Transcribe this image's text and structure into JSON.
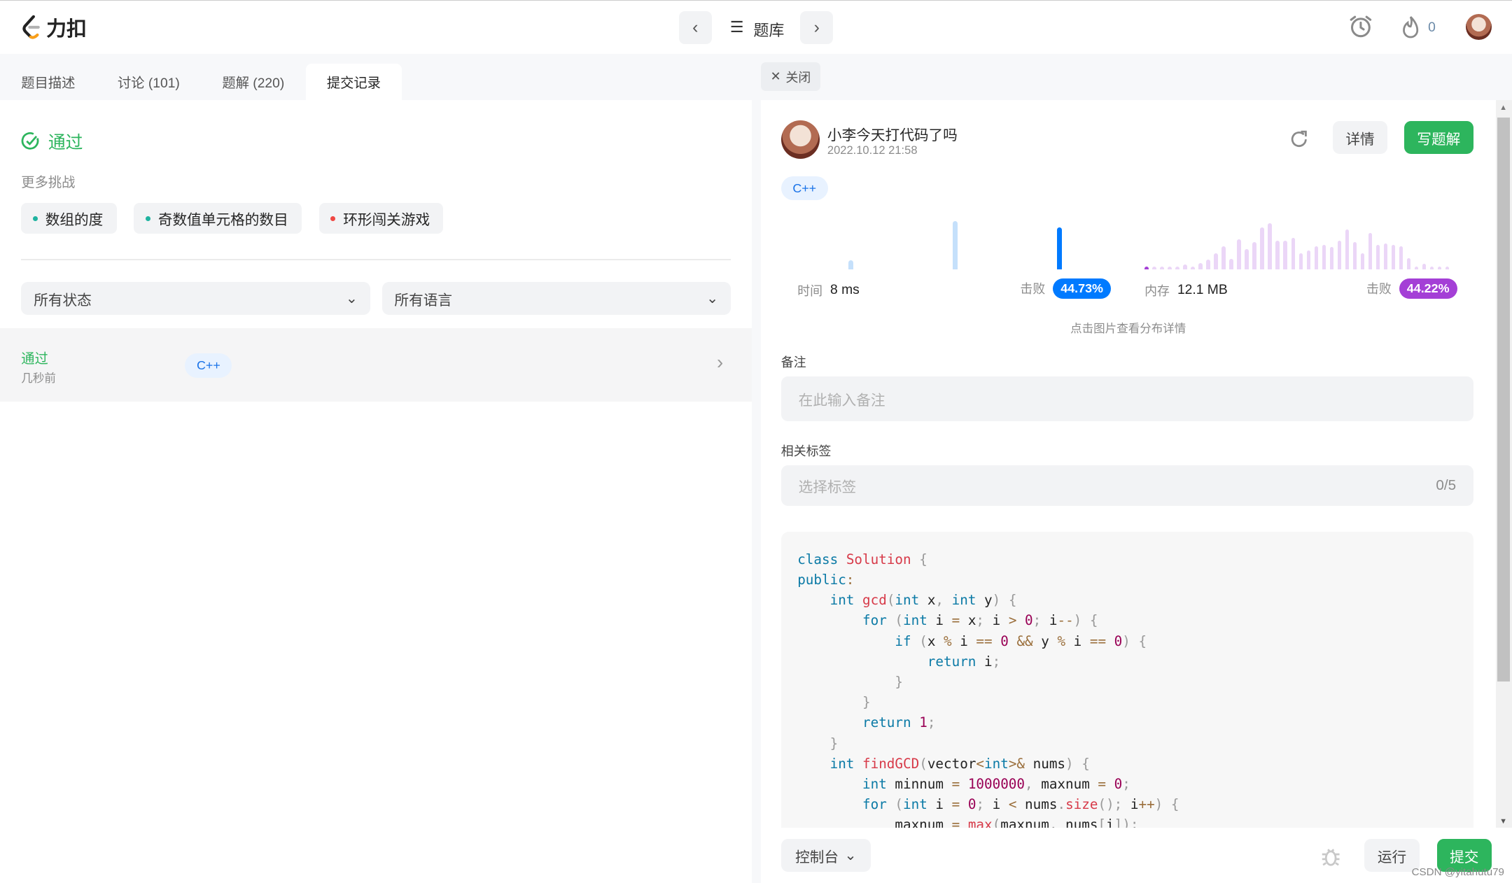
{
  "app": {
    "logo_text": "力扣",
    "center_title": "题库",
    "streak_count": "0"
  },
  "tabs": [
    {
      "label": "题目描述"
    },
    {
      "label": "讨论 (101)"
    },
    {
      "label": "题解 (220)"
    },
    {
      "label": "提交记录"
    }
  ],
  "left": {
    "status": "通过",
    "more_label": "更多挑战",
    "challenges": [
      {
        "label": "数组的度",
        "color": "#1fb3a0"
      },
      {
        "label": "奇数值单元格的数目",
        "color": "#1fb3a0"
      },
      {
        "label": "环形闯关游戏",
        "color": "#ef4743"
      }
    ],
    "status_filter": "所有状态",
    "language_filter": "所有语言",
    "submission": {
      "status": "通过",
      "time": "几秒前",
      "language": "C++"
    }
  },
  "right": {
    "close_label": "关闭",
    "user": "小李今天打代码了吗",
    "datetime": "2022.10.12 21:58",
    "detail_label": "详情",
    "write_solution_label": "写题解",
    "language": "C++",
    "time_label": "时间",
    "time_value": "8 ms",
    "beat_label": "击败",
    "time_beat": "44.73%",
    "memory_label": "内存",
    "memory_value": "12.1 MB",
    "memory_beat": "44.22%",
    "hint": "点击图片查看分布详情",
    "note_label": "备注",
    "note_placeholder": "在此输入备注",
    "tags_label": "相关标签",
    "tags_placeholder": "选择标签",
    "tags_count": "0/5",
    "console_label": "控制台",
    "run_label": "运行",
    "submit_label": "提交",
    "watermark": "CSDN @yitahutu79"
  },
  "colors": {
    "accent": "#2db55d",
    "time_bar": "#c5e0fb",
    "time_bar_current": "#007aff",
    "memory_bar": "#ebd6f7",
    "memory_bar_current": "#a43fd6"
  },
  "time_distribution": [
    {
      "value": 20,
      "current": false
    },
    {
      "value": 100,
      "current": false
    },
    {
      "value": 88,
      "current": true
    }
  ],
  "memory_distribution": [
    5,
    4,
    4,
    4,
    4,
    11,
    5,
    14,
    21,
    35,
    50,
    23,
    66,
    44,
    59,
    91,
    100,
    62,
    62,
    68,
    35,
    41,
    50,
    53,
    49,
    62,
    86,
    59,
    35,
    79,
    54,
    57,
    53,
    50,
    25,
    6,
    12,
    6,
    6,
    7
  ],
  "code": [
    [
      [
        "k",
        "class"
      ],
      [
        "t",
        " "
      ],
      [
        "f",
        "Solution"
      ],
      [
        "t",
        " "
      ],
      [
        "p",
        "{"
      ]
    ],
    [
      [
        "k",
        "public"
      ],
      [
        "o",
        ":"
      ]
    ],
    [
      [
        "t",
        "    "
      ],
      [
        "k",
        "int"
      ],
      [
        "t",
        " "
      ],
      [
        "f",
        "gcd"
      ],
      [
        "p",
        "("
      ],
      [
        "k",
        "int"
      ],
      [
        "t",
        " x"
      ],
      [
        "p",
        ","
      ],
      [
        "t",
        " "
      ],
      [
        "k",
        "int"
      ],
      [
        "t",
        " y"
      ],
      [
        "p",
        ")"
      ],
      [
        "t",
        " "
      ],
      [
        "p",
        "{"
      ]
    ],
    [
      [
        "t",
        "        "
      ],
      [
        "k",
        "for"
      ],
      [
        "t",
        " "
      ],
      [
        "p",
        "("
      ],
      [
        "k",
        "int"
      ],
      [
        "t",
        " i "
      ],
      [
        "o",
        "="
      ],
      [
        "t",
        " x"
      ],
      [
        "p",
        ";"
      ],
      [
        "t",
        " i "
      ],
      [
        "o",
        ">"
      ],
      [
        "t",
        " "
      ],
      [
        "n",
        "0"
      ],
      [
        "p",
        ";"
      ],
      [
        "t",
        " i"
      ],
      [
        "o",
        "--"
      ],
      [
        "p",
        ")"
      ],
      [
        "t",
        " "
      ],
      [
        "p",
        "{"
      ]
    ],
    [
      [
        "t",
        "            "
      ],
      [
        "k",
        "if"
      ],
      [
        "t",
        " "
      ],
      [
        "p",
        "("
      ],
      [
        "t",
        "x "
      ],
      [
        "o",
        "%"
      ],
      [
        "t",
        " i "
      ],
      [
        "o",
        "=="
      ],
      [
        "t",
        " "
      ],
      [
        "n",
        "0"
      ],
      [
        "t",
        " "
      ],
      [
        "o",
        "&&"
      ],
      [
        "t",
        " y "
      ],
      [
        "o",
        "%"
      ],
      [
        "t",
        " i "
      ],
      [
        "o",
        "=="
      ],
      [
        "t",
        " "
      ],
      [
        "n",
        "0"
      ],
      [
        "p",
        ")"
      ],
      [
        "t",
        " "
      ],
      [
        "p",
        "{"
      ]
    ],
    [
      [
        "t",
        "                "
      ],
      [
        "k",
        "return"
      ],
      [
        "t",
        " i"
      ],
      [
        "p",
        ";"
      ]
    ],
    [
      [
        "t",
        "            "
      ],
      [
        "p",
        "}"
      ]
    ],
    [
      [
        "t",
        "        "
      ],
      [
        "p",
        "}"
      ]
    ],
    [
      [
        "t",
        "        "
      ],
      [
        "k",
        "return"
      ],
      [
        "t",
        " "
      ],
      [
        "n",
        "1"
      ],
      [
        "p",
        ";"
      ]
    ],
    [
      [
        "t",
        "    "
      ],
      [
        "p",
        "}"
      ]
    ],
    [
      [
        "t",
        "    "
      ],
      [
        "k",
        "int"
      ],
      [
        "t",
        " "
      ],
      [
        "f",
        "findGCD"
      ],
      [
        "p",
        "("
      ],
      [
        "t",
        "vector"
      ],
      [
        "o",
        "<"
      ],
      [
        "k",
        "int"
      ],
      [
        "o",
        ">&"
      ],
      [
        "t",
        " nums"
      ],
      [
        "p",
        ")"
      ],
      [
        "t",
        " "
      ],
      [
        "p",
        "{"
      ]
    ],
    [
      [
        "t",
        "        "
      ],
      [
        "k",
        "int"
      ],
      [
        "t",
        " minnum "
      ],
      [
        "o",
        "="
      ],
      [
        "t",
        " "
      ],
      [
        "n",
        "1000000"
      ],
      [
        "p",
        ","
      ],
      [
        "t",
        " maxnum "
      ],
      [
        "o",
        "="
      ],
      [
        "t",
        " "
      ],
      [
        "n",
        "0"
      ],
      [
        "p",
        ";"
      ]
    ],
    [
      [
        "t",
        "        "
      ],
      [
        "k",
        "for"
      ],
      [
        "t",
        " "
      ],
      [
        "p",
        "("
      ],
      [
        "k",
        "int"
      ],
      [
        "t",
        " i "
      ],
      [
        "o",
        "="
      ],
      [
        "t",
        " "
      ],
      [
        "n",
        "0"
      ],
      [
        "p",
        ";"
      ],
      [
        "t",
        " i "
      ],
      [
        "o",
        "<"
      ],
      [
        "t",
        " nums"
      ],
      [
        "p",
        "."
      ],
      [
        "f",
        "size"
      ],
      [
        "p",
        "();"
      ],
      [
        "t",
        " i"
      ],
      [
        "o",
        "++"
      ],
      [
        "p",
        ")"
      ],
      [
        "t",
        " "
      ],
      [
        "p",
        "{"
      ]
    ],
    [
      [
        "t",
        "            maxnum "
      ],
      [
        "o",
        "="
      ],
      [
        "t",
        " "
      ],
      [
        "f",
        "max"
      ],
      [
        "p",
        "("
      ],
      [
        "t",
        "maxnum"
      ],
      [
        "p",
        ","
      ],
      [
        "t",
        " nums"
      ],
      [
        "p",
        "["
      ],
      [
        "t",
        "i"
      ],
      [
        "p",
        "]);"
      ]
    ]
  ]
}
